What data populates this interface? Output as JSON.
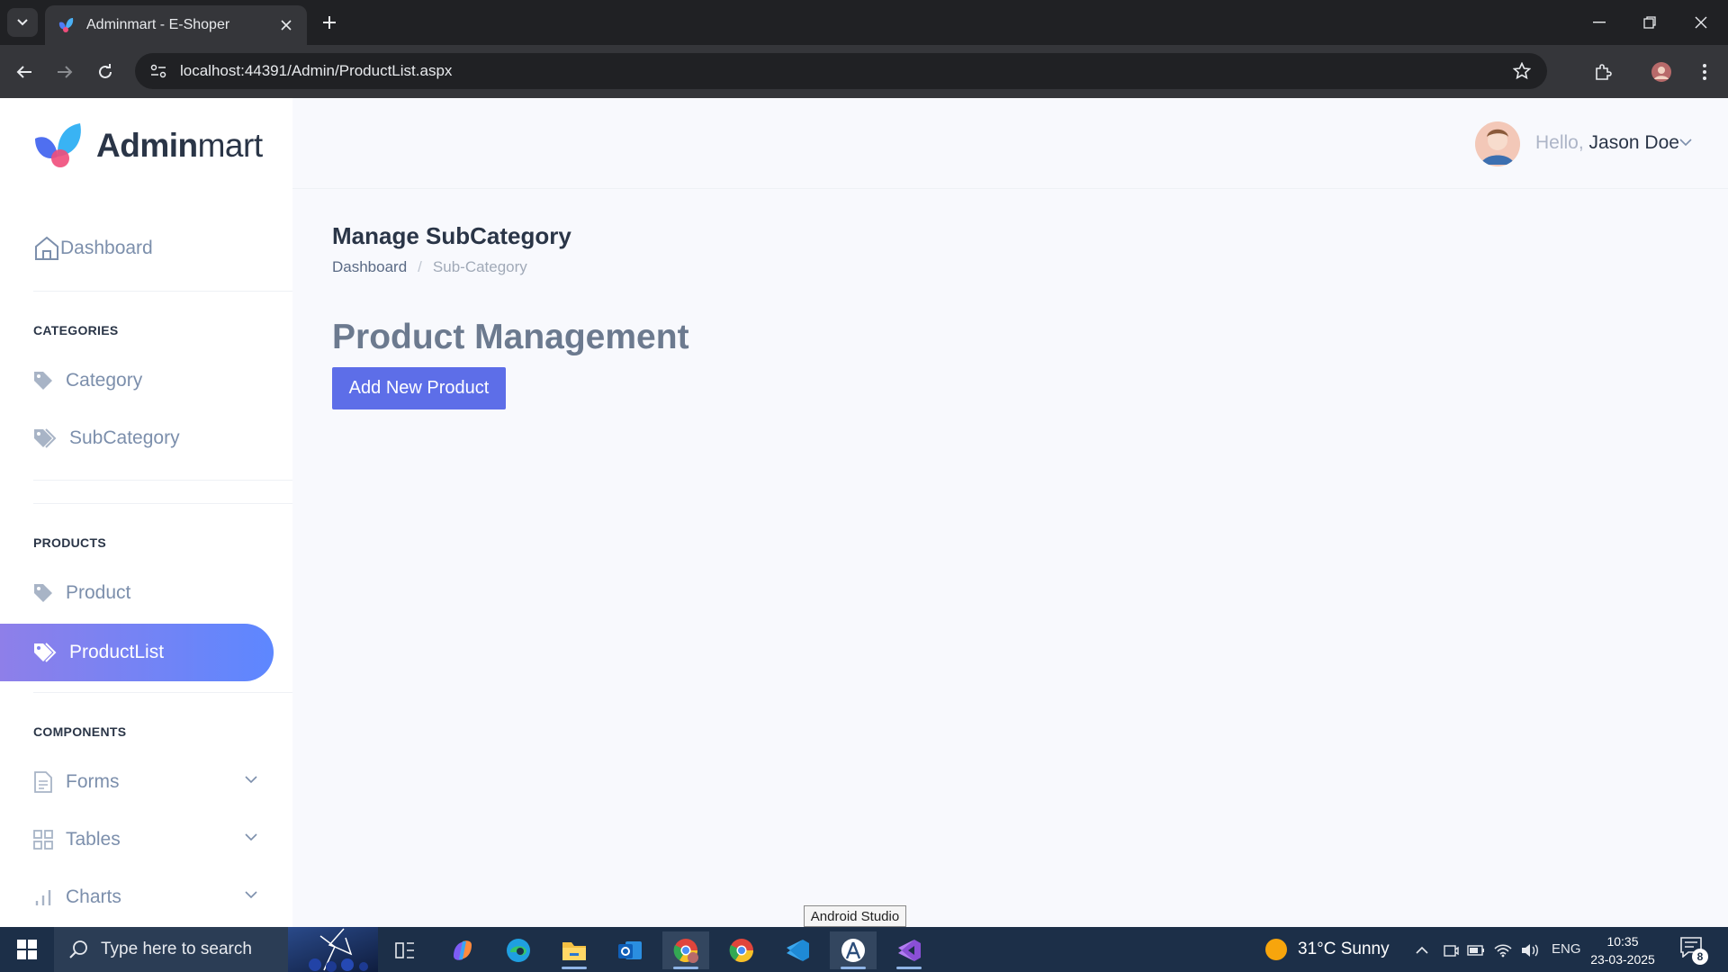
{
  "browser": {
    "tab_title": "Adminmart - E-Shoper",
    "url": "localhost:44391/Admin/ProductList.aspx"
  },
  "sidebar": {
    "logo_bold": "Admin",
    "logo_regular": "mart",
    "dashboard_label": "Dashboard",
    "sections": [
      {
        "heading": "CATEGORIES",
        "items": [
          {
            "label": "Category",
            "icon": "tag-icon"
          },
          {
            "label": "SubCategory",
            "icon": "tags-icon"
          }
        ]
      },
      {
        "heading": "PRODUCTS",
        "items": [
          {
            "label": "Product",
            "icon": "tag-icon"
          },
          {
            "label": "ProductList",
            "icon": "tags-icon",
            "active": true
          }
        ]
      },
      {
        "heading": "COMPONENTS",
        "items": [
          {
            "label": "Forms",
            "icon": "file-text-icon"
          },
          {
            "label": "Tables",
            "icon": "grid-icon"
          },
          {
            "label": "Charts",
            "icon": "bar-chart-icon"
          }
        ]
      }
    ]
  },
  "header": {
    "greeting": "Hello,",
    "user_name": "Jason Doe"
  },
  "main": {
    "page_title": "Manage SubCategory",
    "breadcrumb": {
      "home": "Dashboard",
      "separator": "/",
      "current": "Sub-Category"
    },
    "section_heading": "Product Management",
    "add_button_label": "Add New Product"
  },
  "tooltip": "Android Studio",
  "taskbar": {
    "search_placeholder": "Type here to search",
    "weather": "31°C  Sunny",
    "language": "ENG",
    "time": "10:35",
    "date": "23-03-2025",
    "notification_count": "8"
  },
  "colors": {
    "accent": "#5d87ff",
    "accent_gradient_start": "#8e7fe9",
    "button": "#5d6ee8",
    "heading": "#2a3547",
    "muted": "#7c8fac"
  }
}
